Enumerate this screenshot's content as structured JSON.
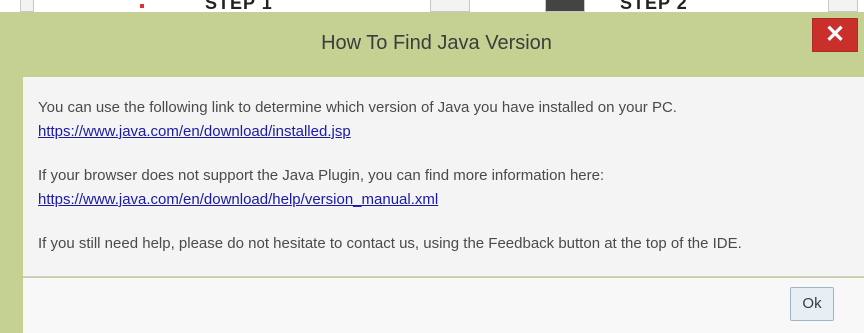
{
  "dialog": {
    "title": "How To Find Java Version",
    "close_label": "✕",
    "paragraph_1": "You can use the following link to determine which version of Java you have installed on your PC.",
    "link_1": "https://www.java.com/en/download/installed.jsp",
    "paragraph_2": "If your browser does not support the Java Plugin, you can find more information here:",
    "link_2": "https://www.java.com/en/download/help/version_manual.xml",
    "paragraph_3": "If you still need help, please do not hesitate to contact us, using the Feedback button at the top of the IDE.",
    "ok_label": "Ok"
  },
  "background": {
    "step_text_1": "STEP 1",
    "step_text_2": "STEP 2"
  },
  "colors": {
    "title_bar": "#c5d192",
    "close_button": "#c9302c",
    "link": "#1a1aa6",
    "body_panel": "#f4f4f4"
  },
  "icons": {
    "close": "close-icon"
  }
}
